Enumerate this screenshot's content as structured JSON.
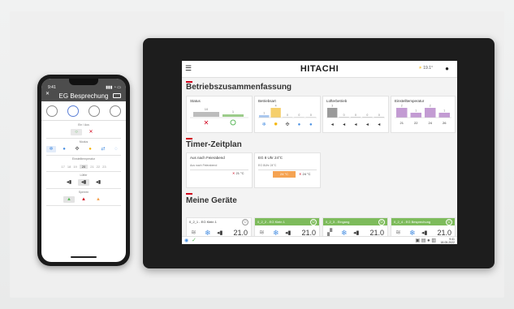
{
  "phone": {
    "status_time": "9:41",
    "title": "EG Besprechung",
    "sections": {
      "on_off": "Ein / Aus",
      "mode": "Modus",
      "set_temp": "Einstelltemperatur",
      "fan": "Lüfter",
      "lock": "Sperren"
    },
    "temp_scale": [
      "17",
      "18",
      "19",
      "20",
      "21",
      "22",
      "23"
    ],
    "temp_selected": "20"
  },
  "tablet": {
    "brand": "HITACHI",
    "weather": "19.1°",
    "sections": {
      "overview": "Betriebszusammenfassung",
      "timer": "Timer-Zeitplan",
      "devices": "Meine Geräte"
    },
    "status_cards": [
      {
        "title": "Status"
      },
      {
        "title": "Betriebsart"
      },
      {
        "title": "Lüfterbetrieb"
      },
      {
        "title": "Einstelltemperatur"
      }
    ],
    "status_values": {
      "off": 10,
      "on": 1
    },
    "mode_values": [
      1,
      4,
      0,
      0,
      0
    ],
    "fan_values": [
      3,
      0,
      0,
      0,
      0
    ],
    "temp_values": [
      {
        "label": "21",
        "value": 2
      },
      {
        "label": "22",
        "value": 1
      },
      {
        "label": "24",
        "value": 2
      },
      {
        "label": "26",
        "value": 1
      }
    ],
    "timer_cards": [
      {
        "title": "Aus nach Feierabend",
        "sub": "Aus nach Feierabend",
        "event": "21 °C"
      },
      {
        "title": "EG 8 Uhr 24°C",
        "sub": "EG 8Uhr 24°C",
        "event_a": "24 °C",
        "event_b": "24 °C"
      }
    ],
    "devices": [
      {
        "name": "0_2_1 - EG Klein 1",
        "temp": "21.0",
        "on": false
      },
      {
        "name": "0_2_2 - EG Klein 1",
        "temp": "21.0",
        "on": true
      },
      {
        "name": "0_2_3 - Eingang",
        "temp": "21.0",
        "on": true
      },
      {
        "name": "0_2_4 - EG Besprechung",
        "temp": "21.0",
        "on": true
      }
    ],
    "footer_time": "9:41",
    "footer_date": "18.05.2022"
  },
  "colors": {
    "brand_red": "#d0021b",
    "on_green": "#7dbb5b",
    "cool_blue": "#4a90e2",
    "warm_orange": "#f5a352",
    "temp_purple": "#c39bd3"
  }
}
